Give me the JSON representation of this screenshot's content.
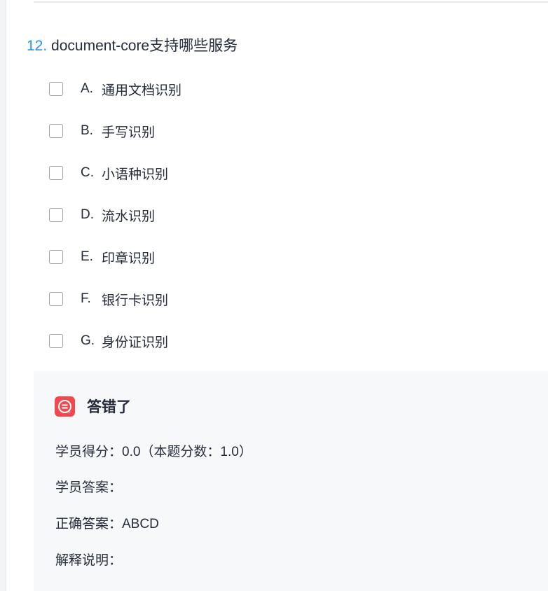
{
  "question": {
    "number": "12.",
    "text": "document-core支持哪些服务"
  },
  "options": [
    {
      "letter": "A.",
      "text": "通用文档识别",
      "checked": false
    },
    {
      "letter": "B.",
      "text": "手写识别",
      "checked": false
    },
    {
      "letter": "C.",
      "text": "小语种识别",
      "checked": false
    },
    {
      "letter": "D.",
      "text": "流水识别",
      "checked": false
    },
    {
      "letter": "E.",
      "text": "印章识别",
      "checked": false
    },
    {
      "letter": "F.",
      "text": "银行卡识别",
      "checked": false
    },
    {
      "letter": "G.",
      "text": "身份证识别",
      "checked": false
    }
  ],
  "feedback": {
    "icon": "wrong-answer-chat-icon",
    "icon_color": "#f1494f",
    "status": "答错了",
    "score": "学员得分：0.0（本题分数：1.0）",
    "student_answer": "学员答案：",
    "correct_answer": "正确答案：ABCD",
    "explanation": "解释说明："
  }
}
